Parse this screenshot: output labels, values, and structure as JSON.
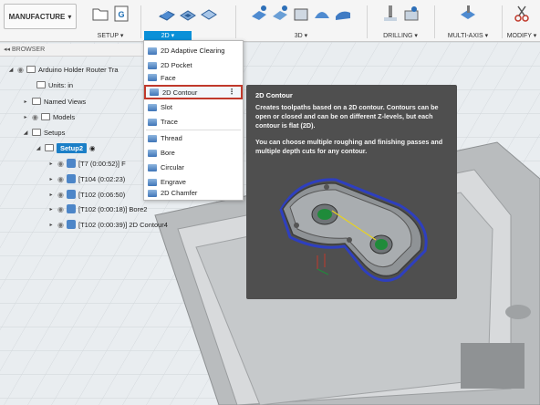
{
  "toolbar": {
    "workspace_label": "MANUFACTURE",
    "groups": {
      "setup": "SETUP",
      "twod": "2D",
      "threed": "3D",
      "drilling": "DRILLING",
      "multiaxis": "MULTI-AXIS",
      "modify": "MODIFY"
    }
  },
  "browser": {
    "header": "BROWSER",
    "items": [
      {
        "label": "Arduino Holder Router Tra"
      },
      {
        "label": "Units: in"
      },
      {
        "label": "Named Views"
      },
      {
        "label": "Models"
      },
      {
        "label": "Setups"
      },
      {
        "label": "Setup2"
      },
      {
        "label": "[T7 (0:00:52)] F"
      },
      {
        "label": "[T104 (0:02:23)"
      },
      {
        "label": "[T102 (0:06:50)"
      },
      {
        "label": "[T102 (0:00:18)] Bore2"
      },
      {
        "label": "[T102 (0:00:39)] 2D Contour4"
      }
    ]
  },
  "menu": {
    "items": [
      {
        "label": "2D Adaptive Clearing"
      },
      {
        "label": "2D Pocket"
      },
      {
        "label": "Face"
      },
      {
        "label": "2D Contour",
        "highlighted": true
      },
      {
        "label": "Slot"
      },
      {
        "label": "Trace"
      },
      {
        "label": "Thread"
      },
      {
        "label": "Bore"
      },
      {
        "label": "Circular"
      },
      {
        "label": "Engrave"
      },
      {
        "label": "2D Chamfer"
      }
    ]
  },
  "tooltip": {
    "title": "2D Contour",
    "para1": "Creates toolpaths based on a 2D contour. Contours can be open or closed and can be on different Z-levels, but each contour is flat (2D).",
    "para2": "You can choose multiple roughing and finishing passes and multiple depth cuts for any contour."
  },
  "colors": {
    "accent": "#0a90d8",
    "highlight": "#c0392b",
    "selected": "#1b7fc7"
  }
}
